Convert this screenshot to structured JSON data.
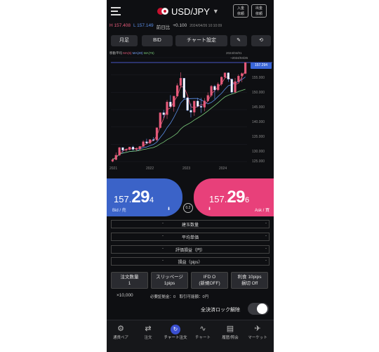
{
  "header": {
    "pair": "USD/JPY",
    "btn_deposit": [
      "入金",
      "依頼"
    ],
    "btn_withdraw": [
      "出金",
      "依頼"
    ]
  },
  "info": {
    "high": "H 157.408",
    "low": "L 157.149",
    "prev_label": "前日比",
    "prev_value": "+0.100",
    "datetime": "2024/04/26 10:10:09"
  },
  "toolbar": {
    "period": "月足",
    "side": "BID",
    "chart_settings": "チャート設定",
    "draw_icon": "pen-icon",
    "rotate_icon": "rotate-icon"
  },
  "chart": {
    "legend_label": "移動平均",
    "ma1": "MA(5)",
    "ma2": "MA(20)",
    "ma3": "MA(75)",
    "date_top": "2024/04/01",
    "date_sub": "~2024/04/26",
    "price_tag": "157.294",
    "y_labels": [
      "155.000",
      "150.000",
      "145.000",
      "140.000",
      "135.000",
      "130.000",
      "125.000"
    ],
    "x_labels": [
      "2021",
      "2022",
      "2023",
      "2024"
    ]
  },
  "chart_data": {
    "type": "candlestick",
    "title": "",
    "series": [
      {
        "name": "MA(5)",
        "color": "#e65a7a"
      },
      {
        "name": "MA(20)",
        "color": "#5b8ee6"
      },
      {
        "name": "MA(75)",
        "color": "#7acb7a"
      }
    ],
    "ylim": [
      103,
      160
    ],
    "x_labels": [
      "2021",
      "2022",
      "2023",
      "2024"
    ],
    "last_price": 157.294,
    "candles": [
      [
        103.2,
        104.9,
        102.6,
        104.1
      ],
      [
        104.1,
        108.0,
        103.8,
        106.5
      ],
      [
        106.5,
        111.0,
        106.0,
        110.7
      ],
      [
        110.7,
        110.9,
        107.5,
        109.3
      ],
      [
        109.3,
        110.2,
        108.4,
        109.6
      ],
      [
        109.6,
        111.0,
        109.2,
        111.0
      ],
      [
        111.0,
        111.7,
        109.1,
        109.7
      ],
      [
        109.7,
        110.8,
        108.8,
        110.0
      ],
      [
        110.0,
        111.6,
        109.1,
        111.3
      ],
      [
        111.3,
        114.7,
        111.2,
        113.9
      ],
      [
        113.9,
        115.5,
        112.5,
        113.2
      ],
      [
        113.2,
        115.2,
        112.6,
        115.1
      ],
      [
        115.1,
        116.4,
        114.2,
        114.9
      ],
      [
        114.9,
        115.8,
        114.2,
        121.6
      ],
      [
        121.6,
        125.1,
        121.3,
        129.8
      ],
      [
        129.8,
        131.3,
        126.9,
        128.7
      ],
      [
        128.7,
        136.7,
        126.4,
        135.7
      ],
      [
        135.7,
        139.4,
        135.5,
        133.1
      ],
      [
        133.1,
        137.4,
        130.4,
        138.9
      ],
      [
        138.9,
        145.9,
        138.7,
        144.7
      ],
      [
        144.7,
        151.9,
        143.5,
        148.7
      ],
      [
        148.7,
        148.8,
        137.5,
        138.0
      ],
      [
        138.0,
        138.4,
        130.7,
        131.1
      ],
      [
        131.1,
        134.8,
        127.2,
        130.1
      ],
      [
        130.1,
        135.1,
        128.1,
        136.2
      ],
      [
        136.2,
        137.9,
        132.8,
        133.3
      ],
      [
        133.3,
        137.9,
        129.7,
        132.8
      ],
      [
        132.8,
        137.8,
        130.6,
        136.3
      ],
      [
        136.3,
        140.9,
        137.5,
        139.3
      ],
      [
        139.3,
        145.0,
        138.4,
        144.3
      ],
      [
        144.3,
        145.1,
        137.2,
        142.3
      ],
      [
        142.3,
        146.5,
        141.5,
        145.5
      ],
      [
        145.5,
        149.7,
        144.5,
        149.3
      ],
      [
        149.3,
        151.7,
        148.8,
        151.7
      ],
      [
        151.7,
        151.9,
        146.7,
        148.2
      ],
      [
        148.2,
        148.6,
        140.2,
        141.0
      ],
      [
        141.0,
        148.8,
        140.8,
        146.9
      ],
      [
        146.9,
        150.8,
        146.5,
        149.9
      ],
      [
        149.9,
        151.9,
        146.5,
        151.3
      ],
      [
        151.3,
        157.4,
        151.0,
        157.3
      ]
    ]
  },
  "bid": {
    "prefix": "157.",
    "big": "29",
    "small": "4",
    "label": "Bid / 売"
  },
  "ask": {
    "prefix": "157.",
    "big": "29",
    "small": "6",
    "label": "Ask / 買"
  },
  "spread": "0.2",
  "order_rows": [
    {
      "label": "建玉数量",
      "mk_l": "-",
      "mk_r": "-"
    },
    {
      "label": "平均単価",
      "mk_l": "-",
      "mk_r": "-"
    },
    {
      "label": "評価損益（円）",
      "mk_l": "-",
      "mk_r": "-"
    },
    {
      "label": "損益（pips）",
      "mk_l": "-",
      "mk_r": "-"
    }
  ],
  "options": [
    {
      "l1": "注文数量",
      "l2": "1"
    },
    {
      "l1": "スリッページ",
      "l2": "1pips"
    },
    {
      "l1": "IFD O",
      "l2": "(新規OFF)"
    },
    {
      "l1": "利食 10pips",
      "l2": "損切 Off"
    }
  ],
  "units": "×10,000",
  "margin_info": "必要証拠金：0　取引可能額：0円",
  "lock_label": "全決済ロック解除",
  "nav": [
    {
      "icon": "⚙",
      "label": "通貨ペア",
      "name": "nav-currency-pair"
    },
    {
      "icon": "⇄",
      "label": "注文",
      "name": "nav-order"
    },
    {
      "icon": "↻",
      "label": "チャート注文",
      "name": "nav-chart-order",
      "active": true
    },
    {
      "icon": "∿",
      "label": "チャート",
      "name": "nav-chart"
    },
    {
      "icon": "▤",
      "label": "履歴/照会",
      "name": "nav-history"
    },
    {
      "icon": "✈",
      "label": "マーケット",
      "name": "nav-market"
    }
  ]
}
